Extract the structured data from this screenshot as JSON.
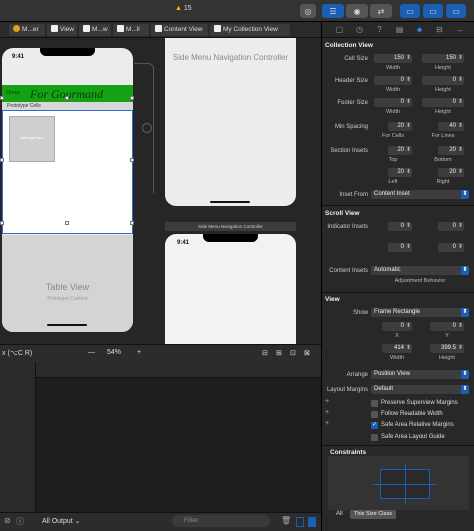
{
  "toolbar": {
    "warning_count": "15",
    "buttons": [
      "target-icon",
      "editor-standard-icon",
      "editor-assistant-icon",
      "editor-version-icon",
      "navigator-toggle",
      "debug-toggle",
      "inspector-toggle"
    ]
  },
  "jumpbar": {
    "tabs": [
      {
        "label": "M...er",
        "icon": "storyboard-icon"
      },
      {
        "label": "View"
      },
      {
        "label": "M...w"
      },
      {
        "label": "M...ll"
      },
      {
        "label": "Content View"
      },
      {
        "label": "My Collection View"
      }
    ]
  },
  "canvas": {
    "phone1": {
      "green_small_text": "Home",
      "green_title": "For Gourmand",
      "prototype_cells": "Prototype Cells",
      "image_label": "UIImageView",
      "table_view": "Table View",
      "table_sub": "Prototype Content"
    },
    "phone2": {
      "title": "Side Menu Navigation Controller"
    },
    "scene_label": "Side Menu Navigation Controller",
    "phone3": {
      "time": "9:41"
    },
    "phone1_time": "9:41"
  },
  "canvas_bar": {
    "appearance": "x (⌥C R)",
    "zoom": "54%",
    "minus": "—",
    "plus": "+"
  },
  "debug": {
    "all_output": "All Output ⌄",
    "filter_placeholder": "Filter"
  },
  "inspector": {
    "collection_view": {
      "header": "Collection View",
      "cell_size": {
        "label": "Cell Size",
        "width": "150",
        "height": "150"
      },
      "header_size": {
        "label": "Header Size",
        "width": "0",
        "height": "0"
      },
      "footer_size": {
        "label": "Footer Size",
        "width": "0",
        "height": "0"
      },
      "min_spacing": {
        "label": "Min Spacing",
        "cells": "20",
        "lines": "40"
      },
      "section_insets": {
        "label": "Section Insets",
        "top": "20",
        "bottom": "20",
        "left": "20",
        "right": "20"
      },
      "inset_from": {
        "label": "Inset From",
        "value": "Content Inset"
      },
      "width_lbl": "Width",
      "height_lbl": "Height",
      "for_cells": "For Cells",
      "for_lines": "For Lines",
      "top_lbl": "Top",
      "bottom_lbl": "Bottom",
      "left_lbl": "Left",
      "right_lbl": "Right"
    },
    "scroll_view": {
      "header": "Scroll View",
      "indicator_insets": {
        "label": "Indicator Insets",
        "a": "0",
        "b": "0",
        "c": "0",
        "d": "0"
      },
      "content_insets": {
        "label": "Content Insets",
        "value": "Automatic"
      },
      "adjustment": "Adjustment Behavior"
    },
    "view": {
      "header": "View",
      "show": {
        "label": "Show",
        "value": "Frame Rectangle"
      },
      "x": "0",
      "y": "0",
      "x_lbl": "X",
      "y_lbl": "Y",
      "w": "414",
      "h": "399.5",
      "w_lbl": "Width",
      "h_lbl": "Height",
      "arrange": {
        "label": "Arrange",
        "value": "Position View"
      },
      "layout_margins": {
        "label": "Layout Margins",
        "value": "Default"
      },
      "checks": [
        {
          "label": "Preserve Superview Margins",
          "on": false
        },
        {
          "label": "Follow Readable Width",
          "on": false
        },
        {
          "label": "Safe Area Relative Margins",
          "on": true
        },
        {
          "label": "Safe Area Layout Guide",
          "on": false
        }
      ]
    },
    "constraints": {
      "header": "Constraints",
      "seg_all": "All",
      "seg_class": "This Size Class"
    }
  },
  "colors": {
    "accent": "#1b5fb5",
    "green": "#14a214",
    "warning": "#f5c400"
  }
}
